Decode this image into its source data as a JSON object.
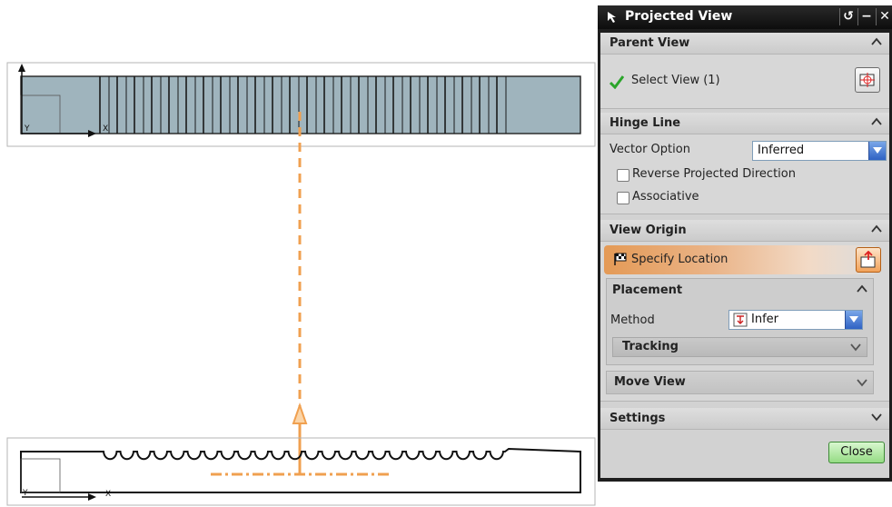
{
  "colors": {
    "part_fill": "#9fb4bd",
    "projection_line": "#f0a050",
    "accent_orange": "#e49a56",
    "close_button": "#95dc84"
  },
  "drawing": {
    "top_view": {
      "axis_y_label": "Y",
      "axis_x_label": "X"
    },
    "bottom_view": {
      "axis_y_label": "Y",
      "axis_x_label": "X"
    }
  },
  "dialog": {
    "title": "Projected View",
    "titlebar_icons": [
      "arrow-icon",
      "reset-icon",
      "minimize-icon",
      "close-icon"
    ],
    "parent_view": {
      "header": "Parent View",
      "select_view_label": "Select View (1)",
      "status_icon": "green-checkmark-icon",
      "select_button_icon": "select-view-icon"
    },
    "hinge_line": {
      "header": "Hinge Line",
      "vector_option_label": "Vector Option",
      "vector_option_value": "Inferred",
      "reverse_label": "Reverse Projected Direction",
      "reverse_checked": false,
      "associative_label": "Associative",
      "associative_checked": false
    },
    "view_origin": {
      "header": "View Origin",
      "specify_location_label": "Specify Location",
      "specify_location_icon": "checkered-flag-icon",
      "location_button_icon": "point-dialog-icon",
      "placement": {
        "header": "Placement",
        "method_label": "Method",
        "method_value": "Infer",
        "tracking_header": "Tracking"
      },
      "move_view_header": "Move View"
    },
    "settings_header": "Settings",
    "close_label": "Close"
  }
}
